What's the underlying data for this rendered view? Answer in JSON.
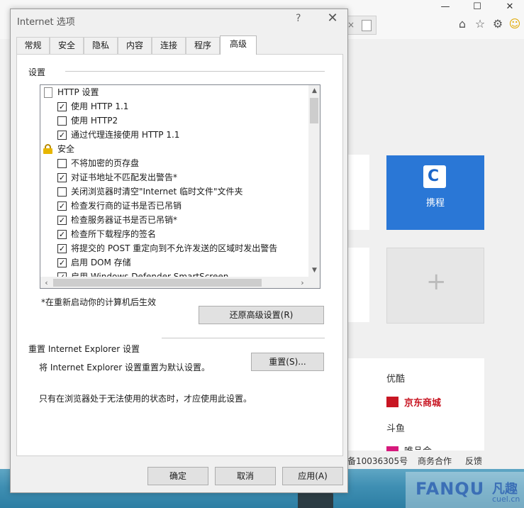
{
  "browser": {
    "window_controls": [
      "—",
      "☐",
      "✕"
    ],
    "tab_close": "×",
    "tile_ctrip_label": "携程",
    "tile_add_symbol": "+",
    "links": [
      "优酷",
      "京东商城",
      "斗鱼",
      "唯品会"
    ],
    "footer": {
      "icp": "备10036305号",
      "business": "商务合作",
      "feedback": "反馈"
    },
    "watermark": {
      "brand": "FANQU",
      "cn": "凡趣",
      "domain": "cuel.cn"
    },
    "colors": {
      "ctrip_blue": "#2a77d6",
      "jd_red": "#c81623"
    }
  },
  "dialog": {
    "title": "Internet 选项",
    "help": "?",
    "close": "✕",
    "tabs": [
      "常规",
      "安全",
      "隐私",
      "内容",
      "连接",
      "程序",
      "高级"
    ],
    "active_tab": "高级",
    "settings_header": "设置",
    "tree": [
      {
        "type": "group",
        "icon": "document-icon",
        "label": "HTTP 设置"
      },
      {
        "type": "check",
        "checked": true,
        "label": "使用 HTTP 1.1"
      },
      {
        "type": "check",
        "checked": false,
        "label": "使用 HTTP2"
      },
      {
        "type": "check",
        "checked": true,
        "label": "通过代理连接使用 HTTP 1.1"
      },
      {
        "type": "group",
        "icon": "lock-icon",
        "label": "安全"
      },
      {
        "type": "check",
        "checked": false,
        "label": "不将加密的页存盘"
      },
      {
        "type": "check",
        "checked": true,
        "label": "对证书地址不匹配发出警告*"
      },
      {
        "type": "check",
        "checked": false,
        "label": "关闭浏览器时清空\"Internet 临时文件\"文件夹"
      },
      {
        "type": "check",
        "checked": true,
        "label": "检查发行商的证书是否已吊销"
      },
      {
        "type": "check",
        "checked": true,
        "label": "检查服务器证书是否已吊销*"
      },
      {
        "type": "check",
        "checked": true,
        "label": "检查所下载程序的签名"
      },
      {
        "type": "check",
        "checked": true,
        "label": "将提交的 POST 重定向到不允许发送的区域时发出警告"
      },
      {
        "type": "check",
        "checked": true,
        "label": "启用 DOM 存储"
      },
      {
        "type": "check",
        "checked": true,
        "label": "启用 Windows Defender SmartScreen"
      }
    ],
    "restart_note": "*在重新启动你的计算机后生效",
    "restore_button": "还原高级设置(R)",
    "reset_header": "重置 Internet Explorer 设置",
    "reset_desc": "将 Internet Explorer 设置重置为默认设置。",
    "reset_button": "重置(S)...",
    "reset_note": "只有在浏览器处于无法使用的状态时，才应使用此设置。",
    "ok_button": "确定",
    "cancel_button": "取消",
    "apply_button": "应用(A)"
  }
}
